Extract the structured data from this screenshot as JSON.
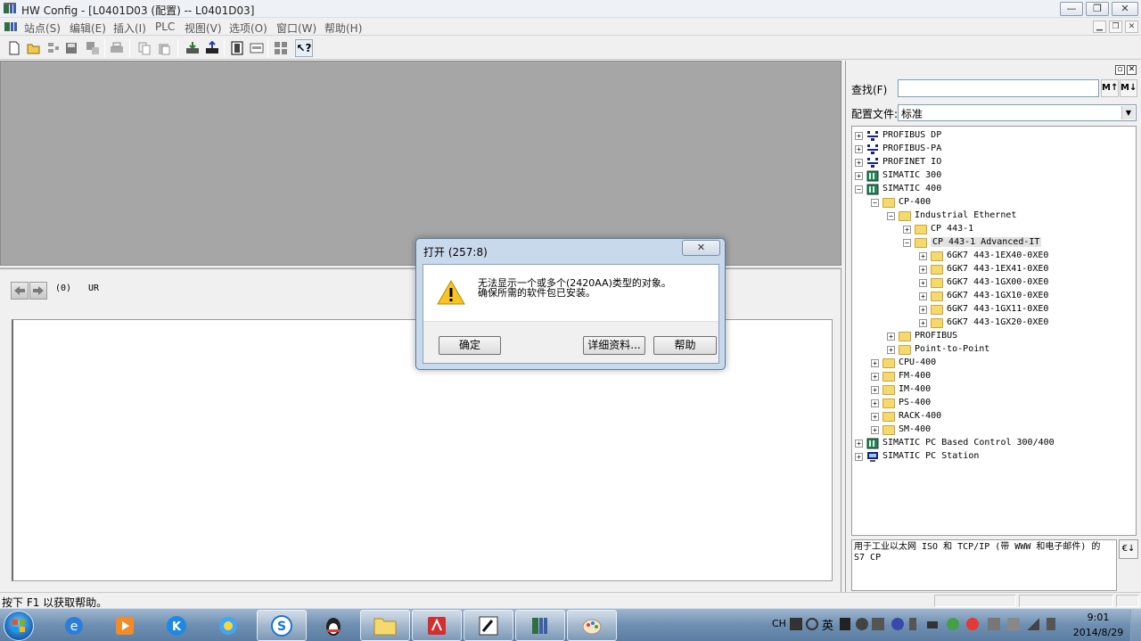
{
  "window": {
    "title": "HW Config - [L0401D03 (配置) -- L0401D03]",
    "min_label": "—",
    "max_label": "❐",
    "close_label": "✕"
  },
  "menu": {
    "items": [
      "站点(S)",
      "编辑(E)",
      "插入(I)",
      "PLC",
      "视图(V)",
      "选项(O)",
      "窗口(W)",
      "帮助(H)"
    ]
  },
  "detail": {
    "rack_number": "(0)",
    "rack_name": "UR"
  },
  "catalog": {
    "search_label": "查找(F)",
    "search_value": "",
    "profile_label": "配置文件:",
    "profile_value": "标准",
    "tree": [
      {
        "label": "PROFIBUS DP",
        "level": 0,
        "expanded": false,
        "icon": "network"
      },
      {
        "label": "PROFIBUS-PA",
        "level": 0,
        "expanded": false,
        "icon": "network"
      },
      {
        "label": "PROFINET IO",
        "level": 0,
        "expanded": false,
        "icon": "network"
      },
      {
        "label": "SIMATIC 300",
        "level": 0,
        "expanded": false,
        "icon": "plc"
      },
      {
        "label": "SIMATIC 400",
        "level": 0,
        "expanded": true,
        "icon": "plc"
      },
      {
        "label": "CP-400",
        "level": 1,
        "expanded": true,
        "icon": "folder"
      },
      {
        "label": "Industrial Ethernet",
        "level": 2,
        "expanded": true,
        "icon": "folder"
      },
      {
        "label": "CP 443-1",
        "level": 3,
        "expanded": false,
        "icon": "folder"
      },
      {
        "label": "CP 443-1 Advanced-IT",
        "level": 3,
        "expanded": true,
        "icon": "folder",
        "selected": true
      },
      {
        "label": "6GK7 443-1EX40-0XE0",
        "level": 4,
        "expanded": false,
        "icon": "folder"
      },
      {
        "label": "6GK7 443-1EX41-0XE0",
        "level": 4,
        "expanded": false,
        "icon": "folder"
      },
      {
        "label": "6GK7 443-1GX00-0XE0",
        "level": 4,
        "expanded": false,
        "icon": "folder"
      },
      {
        "label": "6GK7 443-1GX10-0XE0",
        "level": 4,
        "expanded": false,
        "icon": "folder"
      },
      {
        "label": "6GK7 443-1GX11-0XE0",
        "level": 4,
        "expanded": false,
        "icon": "folder"
      },
      {
        "label": "6GK7 443-1GX20-0XE0",
        "level": 4,
        "expanded": false,
        "icon": "folder"
      },
      {
        "label": "PROFIBUS",
        "level": 2,
        "expanded": false,
        "icon": "folder"
      },
      {
        "label": "Point-to-Point",
        "level": 2,
        "expanded": false,
        "icon": "folder"
      },
      {
        "label": "CPU-400",
        "level": 1,
        "expanded": false,
        "icon": "folder"
      },
      {
        "label": "FM-400",
        "level": 1,
        "expanded": false,
        "icon": "folder"
      },
      {
        "label": "IM-400",
        "level": 1,
        "expanded": false,
        "icon": "folder"
      },
      {
        "label": "PS-400",
        "level": 1,
        "expanded": false,
        "icon": "folder"
      },
      {
        "label": "RACK-400",
        "level": 1,
        "expanded": false,
        "icon": "folder"
      },
      {
        "label": "SM-400",
        "level": 1,
        "expanded": false,
        "icon": "folder"
      },
      {
        "label": "SIMATIC PC Based Control 300/400",
        "level": 0,
        "expanded": false,
        "icon": "plc"
      },
      {
        "label": "SIMATIC PC Station",
        "level": 0,
        "expanded": false,
        "icon": "pc"
      }
    ],
    "description": "用于工业以太网 ISO 和 TCP/IP (带 WWW 和电子邮件) 的 S7 CP"
  },
  "status": {
    "text": "按下 F1 以获取帮助。"
  },
  "dialog": {
    "title": "打开 (257:8)",
    "message_line1": "无法显示一个或多个(2420AA)类型的对象。",
    "message_line2": "确保所需的软件包已安装。",
    "ok_label": "确定",
    "details_label": "详细资料...",
    "help_label": "帮助",
    "close_label": "✕"
  },
  "taskbar": {
    "tray_lang": "CH",
    "tray_ime": "英",
    "time": "9:01",
    "date": "2014/8/29"
  },
  "colors": {
    "station_bg": "#a6a6a6",
    "folder": "#f6d96d",
    "taskbar": "#6e8fb1",
    "dialog_frame": "#c9d9ec"
  }
}
